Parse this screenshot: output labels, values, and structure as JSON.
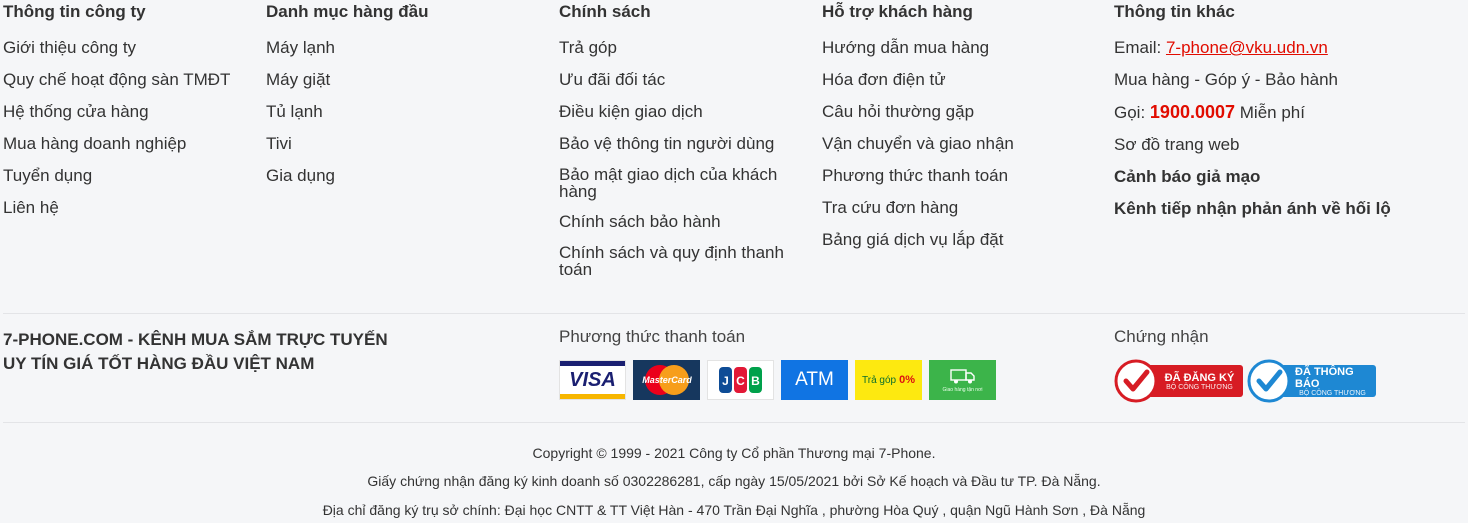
{
  "columns": [
    {
      "title": "Thông tin công ty",
      "items": [
        "Giới thiệu công ty",
        "Quy chế hoạt động sàn TMĐT",
        "Hệ thống cửa hàng",
        "Mua hàng doanh nghiệp",
        "Tuyển dụng",
        "Liên hệ"
      ]
    },
    {
      "title": "Danh mục hàng đầu",
      "items": [
        "Máy lạnh",
        "Máy giặt",
        "Tủ lạnh",
        "Tivi",
        "Gia dụng"
      ]
    },
    {
      "title": "Chính sách",
      "items": [
        "Trả góp",
        "Ưu đãi đối tác",
        "Điều kiện giao dịch",
        "Bảo vệ thông tin người dùng",
        "Bảo mật giao dịch của khách hàng",
        "Chính sách bảo hành",
        "Chính sách và quy định thanh toán"
      ]
    },
    {
      "title": "Hỗ trợ khách hàng",
      "items": [
        "Hướng dẫn mua hàng",
        "Hóa đơn điện tử",
        "Câu hỏi thường gặp",
        "Vận chuyển và giao nhận",
        "Phương thức thanh toán",
        "Tra cứu đơn hàng",
        "Bảng giá dịch vụ lắp đặt"
      ]
    }
  ],
  "other": {
    "title": "Thông tin khác",
    "email_label": "Email:",
    "email": "7-phone@vku.udn.vn",
    "feedback": "Mua hàng - Góp ý - Bảo hành",
    "call_label": "Gọi:",
    "hotline": "1900.0007",
    "free": "Miễn phí",
    "sitemap": "Sơ đồ trang web",
    "warning": "Cảnh báo giả mạo",
    "bribery": "Kênh tiếp nhận phản ánh về hối lộ"
  },
  "brand": {
    "line1": "7-PHONE.COM - KÊNH MUA SẮM TRỰC TUYẾN",
    "line2": "UY TÍN GIÁ TỐT HÀNG ĐẦU VIỆT NAM"
  },
  "payment": {
    "title": "Phương thức thanh toán",
    "visa": "VISA",
    "mastercard": "MasterCard",
    "jcb": "JCB",
    "atm": "ATM",
    "installment": "Trả góp",
    "installment_rate": "0%",
    "delivery": "Giao hàng tận nơi"
  },
  "certification": {
    "title": "Chứng nhận",
    "registered": "ĐÃ ĐĂNG KÝ",
    "notified": "ĐÃ THÔNG BÁO",
    "ministry": "BỘ CÔNG THƯƠNG"
  },
  "footer": {
    "copyright": "Copyright © 1999 - 2021 Công ty Cổ phần Thương mại 7-Phone.",
    "license": "Giấy chứng nhận đăng ký kinh doanh số 0302286281, cấp ngày 15/05/2021 bởi Sở Kế hoạch và Đầu tư TP. Đà Nẵng.",
    "address": "Địa chỉ đăng ký trụ sở chính: Đại học CNTT & TT Việt Hàn - 470 Trần Đại Nghĩa , phường Hòa Quý , quận Ngũ Hành Sơn , Đà Nẵng"
  },
  "colors": {
    "accent": "#e10c00",
    "background": "#f5f6f8"
  }
}
